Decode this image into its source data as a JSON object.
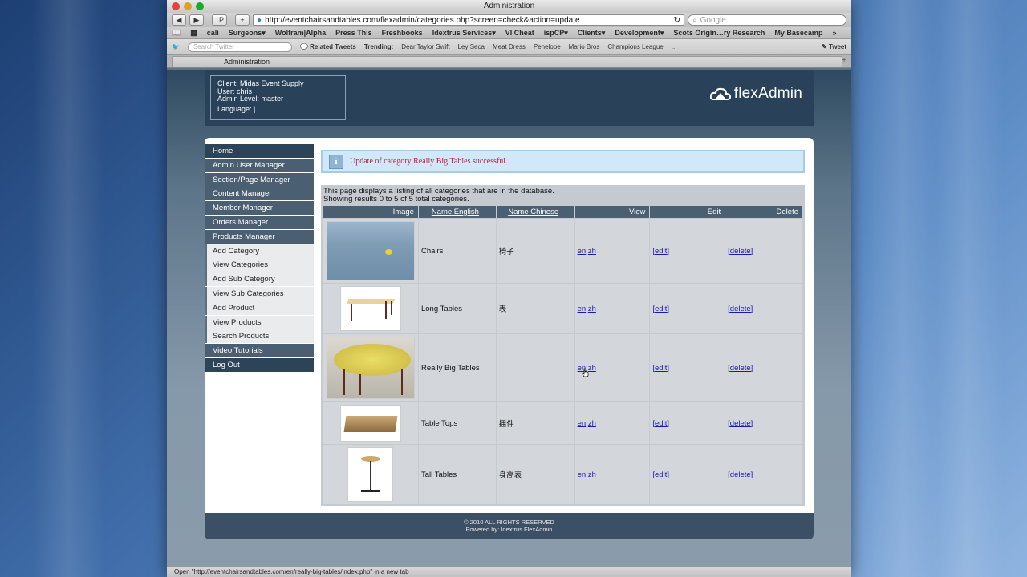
{
  "window": {
    "title": "Administration"
  },
  "toolbar": {
    "back": "◀",
    "forward": "▶",
    "onepassword": "1P",
    "add": "+",
    "url": "http://eventchairsandtables.com/flexadmin/categories.php?screen=check&action=update",
    "reload": "↻",
    "search_placeholder": "Google"
  },
  "bookmarks": [
    "cali",
    "Surgeons▾",
    "Wolfram|Alpha",
    "Press This",
    "Freshbooks",
    "Idextrus Services▾",
    "VI Cheat",
    "ispCP▾",
    "Clients▾",
    "Development▾",
    "Scots Origin…ry Research",
    "My Basecamp",
    "»"
  ],
  "twitter": {
    "search_placeholder": "Search Twitter",
    "related": "Related Tweets",
    "trending_label": "Trending:",
    "trends": [
      "Dear Taylor Swift",
      "Ley Seca",
      "Meat Dress",
      "Penelope",
      "Mario Bros",
      "Champions League",
      "..."
    ],
    "tweet": "Tweet"
  },
  "tab": {
    "label": "Administration",
    "plus": "+"
  },
  "header": {
    "client": "Client: Midas Event Supply",
    "user": "User: chris",
    "level": "Admin Level: master",
    "language": "Language: |",
    "brand": "flexAdmin"
  },
  "nav": [
    {
      "label": "Home",
      "type": "top"
    },
    {
      "label": "Admin User Manager",
      "type": "section"
    },
    {
      "label": "Section/Page Manager",
      "type": "section"
    },
    {
      "label": "Content Manager",
      "type": "section"
    },
    {
      "label": "Member Manager",
      "type": "section"
    },
    {
      "label": "Orders Manager",
      "type": "section"
    },
    {
      "label": "Products Manager",
      "type": "section"
    },
    {
      "label": "Add Category",
      "type": "sub"
    },
    {
      "label": "View Categories",
      "type": "sub"
    },
    {
      "label": "Add Sub Category",
      "type": "sub"
    },
    {
      "label": "View Sub Categories",
      "type": "sub"
    },
    {
      "label": "Add Product",
      "type": "sub"
    },
    {
      "label": "View Products",
      "type": "sub"
    },
    {
      "label": "Search Products",
      "type": "sub"
    },
    {
      "label": "Video Tutorials",
      "type": "section"
    },
    {
      "label": "Log Out",
      "type": "top"
    }
  ],
  "notice": {
    "icon": "i",
    "text": "Update of category Really Big Tables successful."
  },
  "listing": {
    "intro1": "This page displays a listing of all categories that are in the database.",
    "intro2": "Showing results 0 to 5 of 5 total categories.",
    "columns": [
      "Image",
      "Name English",
      "Name Chinese",
      "View",
      "Edit",
      "Delete"
    ],
    "rows": [
      {
        "image": "water-image",
        "en": "Chairs",
        "zh": "椅子",
        "view_en": "en",
        "view_zh": "zh",
        "edit": "[edit]",
        "delete": "[delete]"
      },
      {
        "image": "long-table-image",
        "en": "Long Tables",
        "zh": "表",
        "view_en": "en",
        "view_zh": "zh",
        "edit": "[edit]",
        "delete": "[delete]"
      },
      {
        "image": "round-table-image",
        "en": "Really Big Tables",
        "zh": "",
        "view_en": "en",
        "view_zh": "zh",
        "edit": "[edit]",
        "delete": "[delete]"
      },
      {
        "image": "table-top-image",
        "en": "Table Tops",
        "zh": "摇件",
        "view_en": "en",
        "view_zh": "zh",
        "edit": "[edit]",
        "delete": "[delete]"
      },
      {
        "image": "tall-table-image",
        "en": "Tall Tables",
        "zh": "身高表",
        "view_en": "en",
        "view_zh": "zh",
        "edit": "[edit]",
        "delete": "[delete]"
      }
    ]
  },
  "footer": {
    "line1": "© 2010 ALL RIGHTS RESERVED",
    "line2": "Powered by: Idextrus FlexAdmin"
  },
  "status": "Open \"http://eventchairsandtables.com/en/really-big-tables/index.php\" in a new tab"
}
